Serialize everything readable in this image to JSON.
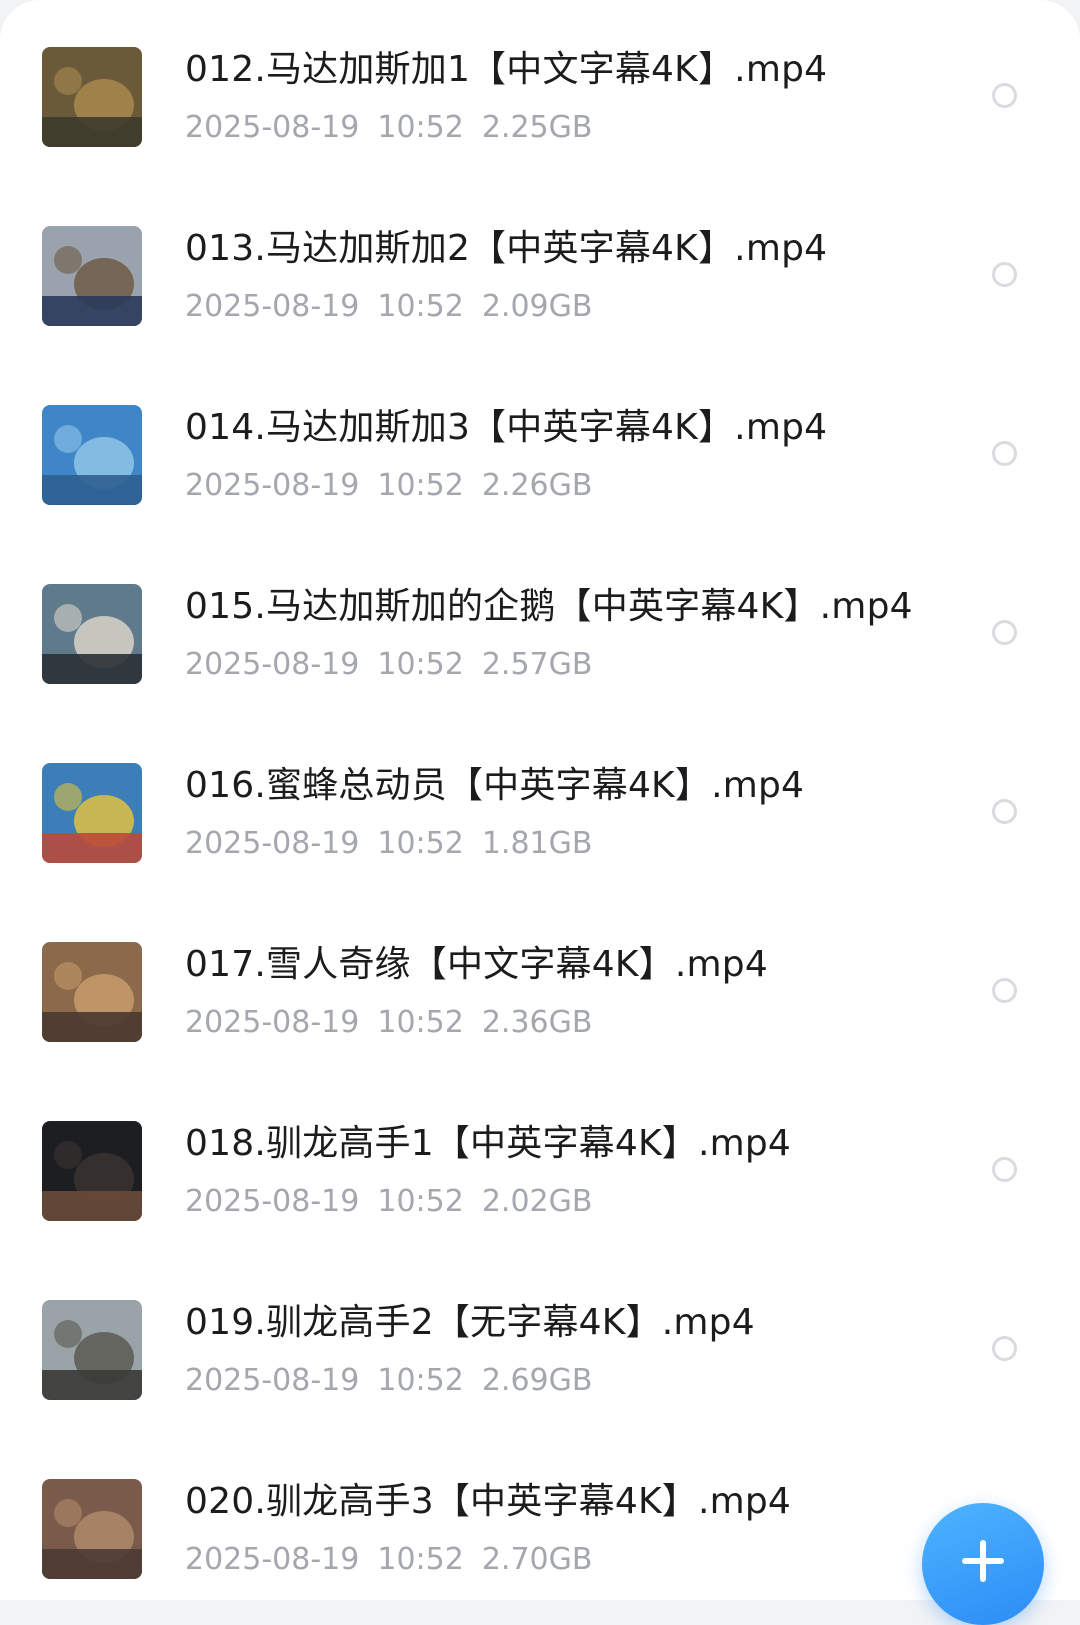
{
  "files": [
    {
      "name": "012.马达加斯加1【中文字幕4K】.mp4",
      "date": "2025-08-19",
      "time": "10:52",
      "size": "2.25GB",
      "thumb_icon": "video-thumbnail",
      "thumb_colors": [
        "#6b5a3a",
        "#a88a4e",
        "#3d3a2c"
      ]
    },
    {
      "name": "013.马达加斯加2【中英字幕4K】.mp4",
      "date": "2025-08-19",
      "time": "10:52",
      "size": "2.09GB",
      "thumb_icon": "video-thumbnail",
      "thumb_colors": [
        "#9aa3ad",
        "#6e5a44",
        "#2a3a5a"
      ]
    },
    {
      "name": "014.马达加斯加3【中英字幕4K】.mp4",
      "date": "2025-08-19",
      "time": "10:52",
      "size": "2.26GB",
      "thumb_icon": "video-thumbnail",
      "thumb_colors": [
        "#3f86c8",
        "#8fc4e8",
        "#2d5f90"
      ]
    },
    {
      "name": "015.马达加斯加的企鹅【中英字幕4K】.mp4",
      "date": "2025-08-19",
      "time": "10:52",
      "size": "2.57GB",
      "thumb_icon": "video-thumbnail",
      "thumb_colors": [
        "#5f7a8a",
        "#d8d4c8",
        "#2a3036"
      ]
    },
    {
      "name": "016.蜜蜂总动员【中英字幕4K】.mp4",
      "date": "2025-08-19",
      "time": "10:52",
      "size": "1.81GB",
      "thumb_icon": "video-thumbnail",
      "thumb_colors": [
        "#3c7fb8",
        "#e0c040",
        "#b84a3a"
      ]
    },
    {
      "name": "017.雪人奇缘【中文字幕4K】.mp4",
      "date": "2025-08-19",
      "time": "10:52",
      "size": "2.36GB",
      "thumb_icon": "video-thumbnail",
      "thumb_colors": [
        "#8a6a4a",
        "#c79a6a",
        "#4a3a30"
      ]
    },
    {
      "name": "018.驯龙高手1【中英字幕4K】.mp4",
      "date": "2025-08-19",
      "time": "10:52",
      "size": "2.02GB",
      "thumb_icon": "video-thumbnail",
      "thumb_colors": [
        "#1c1e22",
        "#3a3430",
        "#6a4a3a"
      ]
    },
    {
      "name": "019.驯龙高手2【无字幕4K】.mp4",
      "date": "2025-08-19",
      "time": "10:52",
      "size": "2.69GB",
      "thumb_icon": "video-thumbnail",
      "thumb_colors": [
        "#9aa4a8",
        "#5a5a52",
        "#3a3a36"
      ]
    },
    {
      "name": "020.驯龙高手3【中英字幕4K】.mp4",
      "date": "2025-08-19",
      "time": "10:52",
      "size": "2.70GB",
      "thumb_icon": "video-thumbnail",
      "thumb_colors": [
        "#7a5a4a",
        "#b08a6a",
        "#4a3a34"
      ]
    }
  ],
  "fab": {
    "icon": "plus-icon",
    "color": "#3a9cf8"
  },
  "colors": {
    "title": "#1c1c1e",
    "meta": "#a4a7ae",
    "radio_border": "#d9dbdf"
  }
}
